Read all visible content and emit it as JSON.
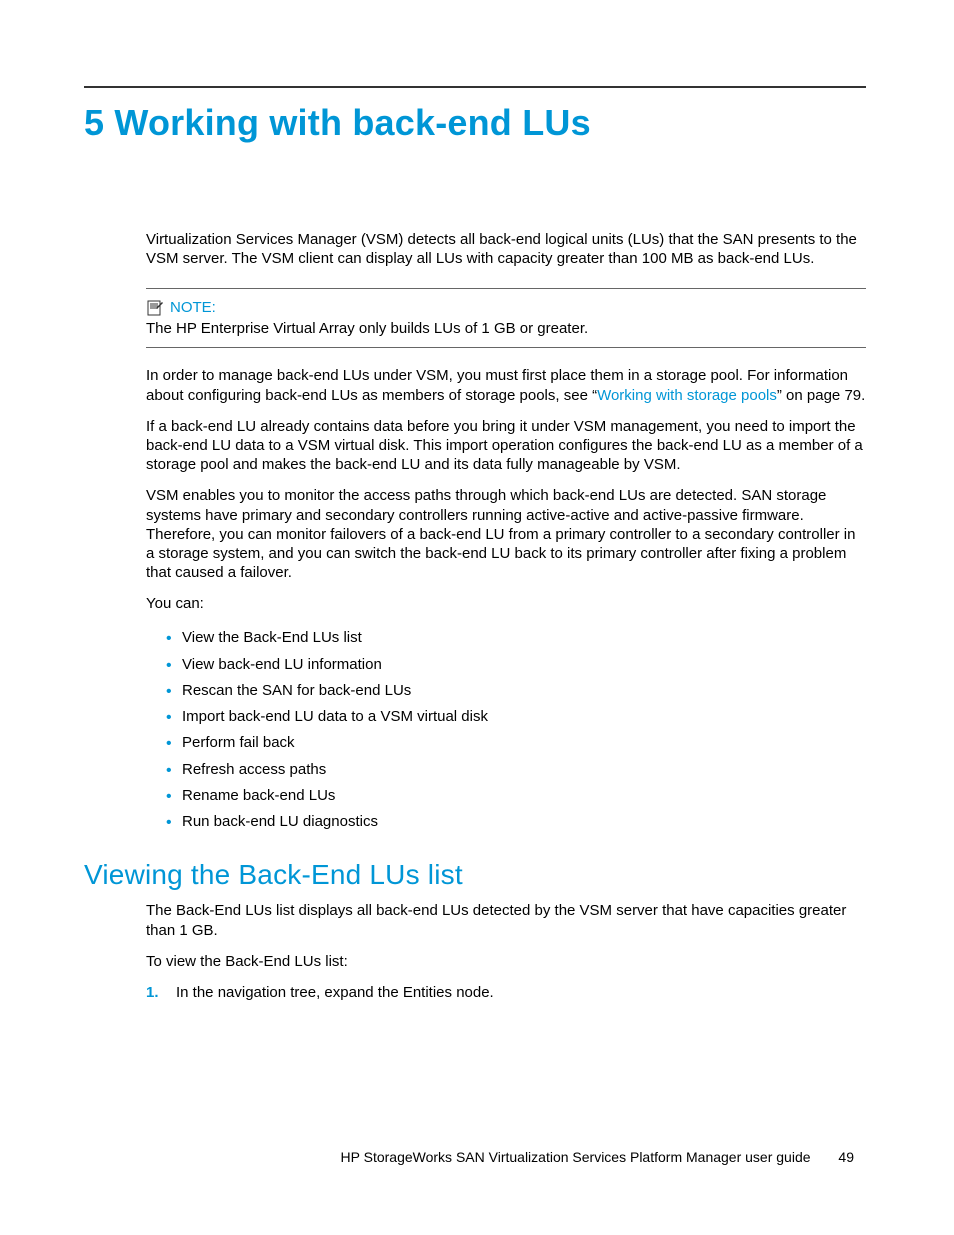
{
  "chapter": {
    "title": "5 Working with back-end LUs"
  },
  "intro": "Virtualization Services Manager (VSM) detects all back-end logical units (LUs) that the SAN presents to the VSM server. The VSM client can display all LUs with capacity greater than 100 MB as back-end LUs.",
  "note": {
    "label": "NOTE:",
    "text": "The HP Enterprise Virtual Array only builds LUs of 1 GB or greater."
  },
  "para_pool_pre": "In order to manage back-end LUs under VSM, you must first place them in a storage pool. For information about configuring back-end LUs as members of storage pools, see “",
  "para_pool_link": "Working with storage pools",
  "para_pool_post": "” on page 79.",
  "para_import": "If a back-end LU already contains data before you bring it under VSM management, you need to import the back-end LU data to a VSM virtual disk. This import operation configures the back-end LU as a member of a storage pool and makes the back-end LU and its data fully manageable by VSM.",
  "para_monitor": "VSM enables you to monitor the access paths through which back-end LUs are detected. SAN storage systems have primary and secondary controllers running active-active and active-passive firmware. Therefore, you can monitor failovers of a back-end LU from a primary controller to a secondary controller in a storage system, and you can switch the back-end LU back to its primary controller after fixing a problem that caused a failover.",
  "you_can": "You can:",
  "actions": [
    "View the Back-End LUs list",
    "View back-end LU information",
    "Rescan the SAN for back-end LUs",
    "Import back-end LU data to a VSM virtual disk",
    "Perform fail back",
    "Refresh access paths",
    "Rename back-end LUs",
    "Run back-end LU diagnostics"
  ],
  "section": {
    "title": "Viewing the Back-End LUs list",
    "intro": "The Back-End LUs list displays all back-end LUs detected by the VSM server that have capacities greater than 1 GB.",
    "lead": "To view the Back-End LUs list:",
    "steps": [
      {
        "num": "1.",
        "text": "In the navigation tree, expand the Entities node."
      }
    ]
  },
  "footer": {
    "text": "HP StorageWorks SAN Virtualization Services Platform Manager user guide",
    "page": "49"
  }
}
